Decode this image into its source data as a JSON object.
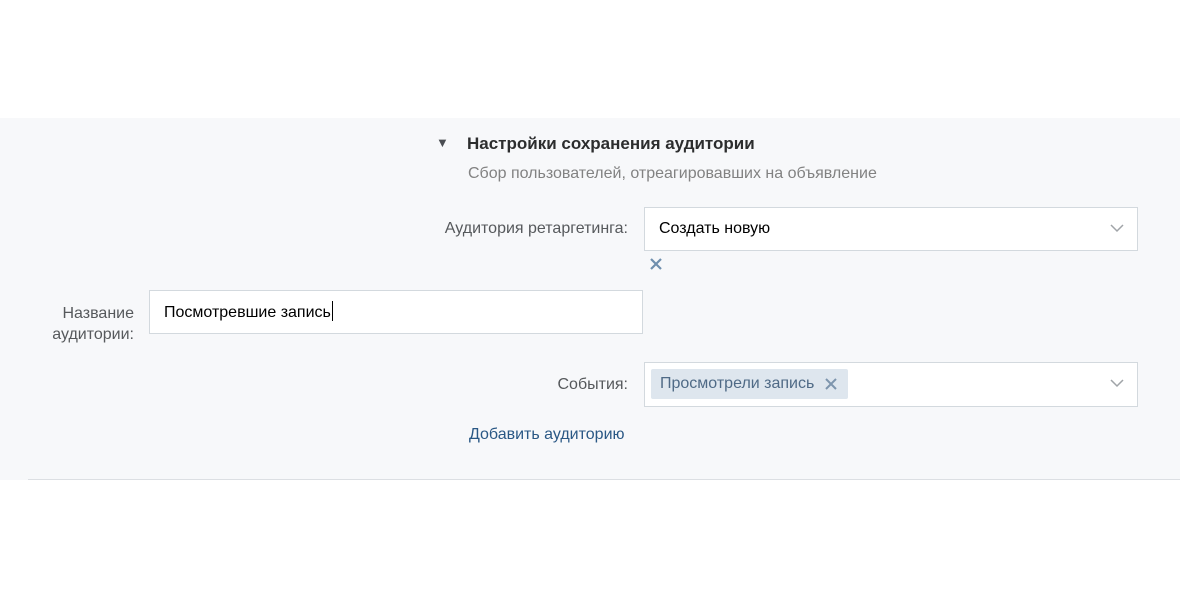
{
  "section": {
    "toggle_icon": "triangle-down-icon",
    "title": "Настройки сохранения аудитории",
    "subtitle": "Сбор пользователей, отреагировавших на объявление"
  },
  "retargeting": {
    "label": "Аудитория ретаргетинга:",
    "selected": "Создать новую",
    "remove_icon": "close-icon"
  },
  "audience_name": {
    "label_line1": "Название",
    "label_line2": "аудитории:",
    "value": "Посмотревшие запись"
  },
  "events": {
    "label": "События:",
    "selected_tokens": [
      "Просмотрели запись"
    ]
  },
  "add_audience_link": "Добавить аудиторию",
  "colors": {
    "panel_bg": "#f7f8fa",
    "link": "#2a5885",
    "token_bg": "#dee6ee",
    "token_text": "#4f6a86",
    "field_border": "#d3d9de"
  }
}
